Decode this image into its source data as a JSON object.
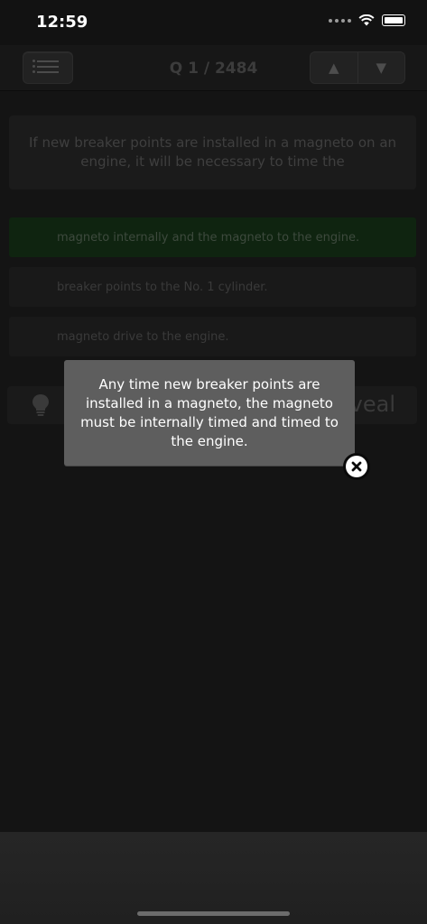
{
  "status_bar": {
    "time": "12:59"
  },
  "nav": {
    "menu_icon": "list-icon",
    "question_counter": "Q 1 / 2484",
    "up_icon": "triangle-up-icon",
    "down_icon": "triangle-down-icon"
  },
  "question": {
    "text": "If new breaker points are installed in a magneto on an engine, it will be necessary to time the"
  },
  "answers": [
    {
      "text": "magneto internally and the magneto to the engine.",
      "correct": true
    },
    {
      "text": "breaker points to the No. 1 cylinder.",
      "correct": false
    },
    {
      "text": "magneto drive to the engine.",
      "correct": false
    }
  ],
  "reveal": {
    "label": "veal",
    "icon": "lightbulb-icon"
  },
  "explanation_popup": {
    "text": "Any time new breaker points are installed in a magneto, the magneto must be internally timed and timed to the engine.",
    "close_icon": "close-icon"
  },
  "colors": {
    "correct_answer_bg": "#0f2410",
    "popup_bg": "#5e5e5e",
    "overlay_dark": "#141414"
  }
}
